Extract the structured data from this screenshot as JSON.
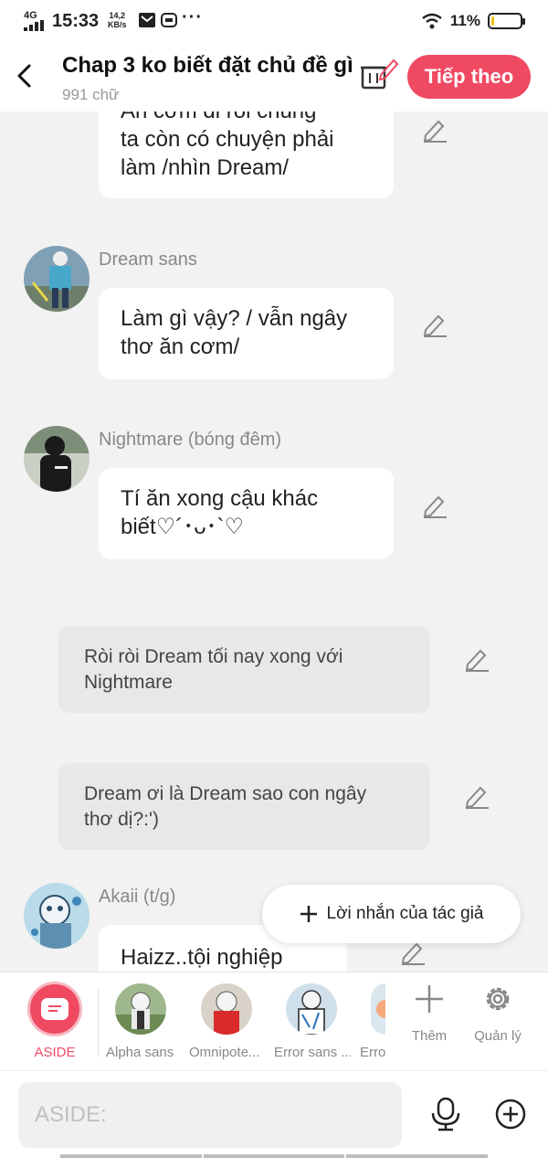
{
  "status_bar": {
    "network": "4G",
    "time": "15:33",
    "speed_value": "14,2",
    "speed_unit": "KB/s",
    "more": "···",
    "battery_pct": "11%",
    "battery_level": 0.11,
    "icons": [
      "signal-icon",
      "mail-icon",
      "zalo-icon",
      "wifi-icon",
      "battery-icon"
    ]
  },
  "header": {
    "title": "Chap 3 ko biết đặt chủ đề gì",
    "word_count": "991 chữ",
    "next_label": "Tiếp theo",
    "accent": "#f04a63"
  },
  "chat": {
    "messages": [
      {
        "speaker": "",
        "text": "Ăn cơm đi rồi chúng\nta còn có chuyện phải\nlàm /nhìn Dream/"
      },
      {
        "speaker": "Dream sans",
        "text": "Làm gì vậy? / vẫn ngây\nthơ ăn cơm/"
      },
      {
        "speaker": "Nightmare (bóng đêm)",
        "text": "Tí ăn xong cậu khác\nbiết♡´･ᴗ･`♡"
      },
      {
        "speaker": "",
        "narration": true,
        "text": "Ròi ròi Dream tối nay xong với\nNightmare"
      },
      {
        "speaker": "",
        "narration": true,
        "text": "Dream ơi là Dream sao con ngây\nthơ dị?:')"
      },
      {
        "speaker": "Akaii (t/g)",
        "text": "Haizz..tội nghiệp nhỏ"
      }
    ],
    "author_note_label": "Lời nhắn của tác giả"
  },
  "character_bar": {
    "aside_label": "ASIDE",
    "characters": [
      {
        "label": "Alpha sans"
      },
      {
        "label": "Omnipote..."
      },
      {
        "label": "Error sans ..."
      },
      {
        "label": "Erro"
      }
    ],
    "add_label": "Thêm",
    "manage_label": "Quản lý"
  },
  "input": {
    "placeholder": "ASIDE:"
  }
}
